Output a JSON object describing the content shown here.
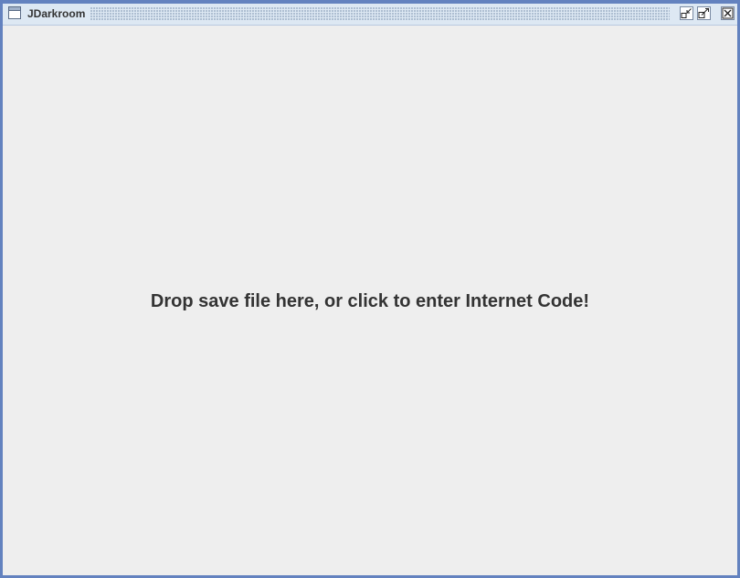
{
  "window": {
    "title": "JDarkroom",
    "icon": "window-icon",
    "buttons": [
      {
        "name": "iconify",
        "icon": "iconify-icon"
      },
      {
        "name": "maximize",
        "icon": "maximize-icon"
      },
      {
        "name": "close",
        "icon": "close-icon"
      }
    ]
  },
  "main": {
    "drop_message": "Drop save file here, or click to enter Internet Code!"
  },
  "colors": {
    "border": "#6382bf",
    "titlebar": "#dde8f3",
    "background": "#eeeeee",
    "text": "#333333"
  }
}
